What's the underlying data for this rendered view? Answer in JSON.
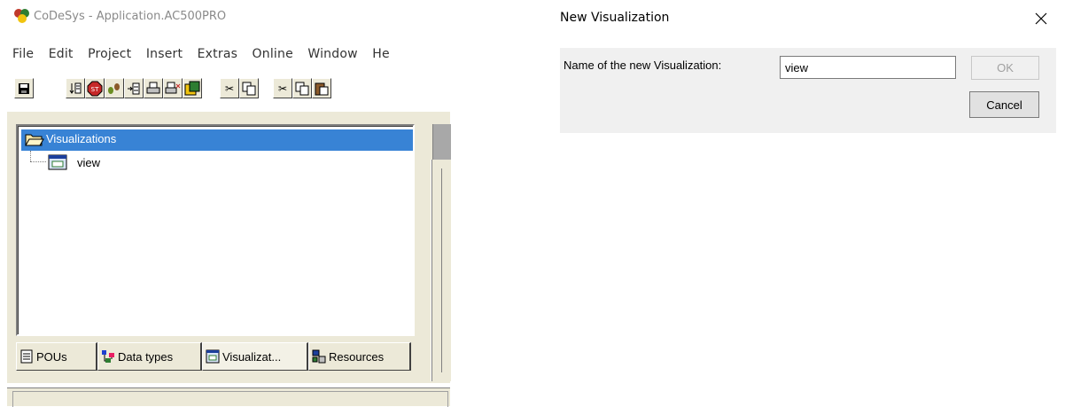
{
  "app": {
    "title": "CoDeSys - Application.AC500PRO",
    "menu": [
      "File",
      "Edit",
      "Project",
      "Insert",
      "Extras",
      "Online",
      "Window",
      "He"
    ],
    "toolbar_icons": [
      "save-icon",
      "insert-icon",
      "stop-icon",
      "step-icon",
      "insert-row-icon",
      "print-icon",
      "print-setup-icon",
      "project-icon",
      "cut-icon",
      "copy-icon",
      "cut-icon",
      "copy-icon",
      "paste-icon"
    ]
  },
  "tree": {
    "root_label": "Visualizations",
    "child_label": "view"
  },
  "tabs": [
    {
      "label": "POUs",
      "icon": "document-icon"
    },
    {
      "label": "Data types",
      "icon": "data-types-icon"
    },
    {
      "label": "Visualizat...",
      "icon": "visualization-icon"
    },
    {
      "label": "Resources",
      "icon": "resources-icon"
    }
  ],
  "dialog": {
    "title": "New Visualization",
    "label": "Name of the new Visualization:",
    "input_value": "view",
    "ok_label": "OK",
    "cancel_label": "Cancel"
  },
  "colors": {
    "selection": "#3883d5",
    "dialog_bg": "#f0f0f0",
    "classic_face": "#ece9d8"
  }
}
